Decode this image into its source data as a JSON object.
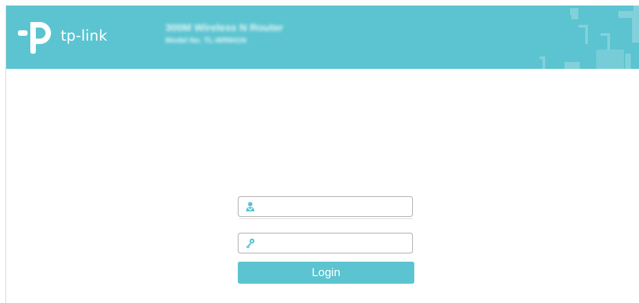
{
  "header": {
    "brand": "tp-link",
    "model_name": "300M Wireless N Router",
    "model_number": "Model No. TL-WR841N"
  },
  "login": {
    "username_placeholder": "",
    "username_value": "",
    "password_placeholder": "",
    "password_value": "",
    "button_label": "Login"
  },
  "icons": {
    "logo": "tp-link-logo-icon",
    "user": "user-icon",
    "password": "key-icon"
  },
  "colors": {
    "brand_teal": "#5bc4d0",
    "deco_light": "#8fd6de",
    "field_border": "#a9a9a9",
    "text_white": "#ffffff"
  }
}
